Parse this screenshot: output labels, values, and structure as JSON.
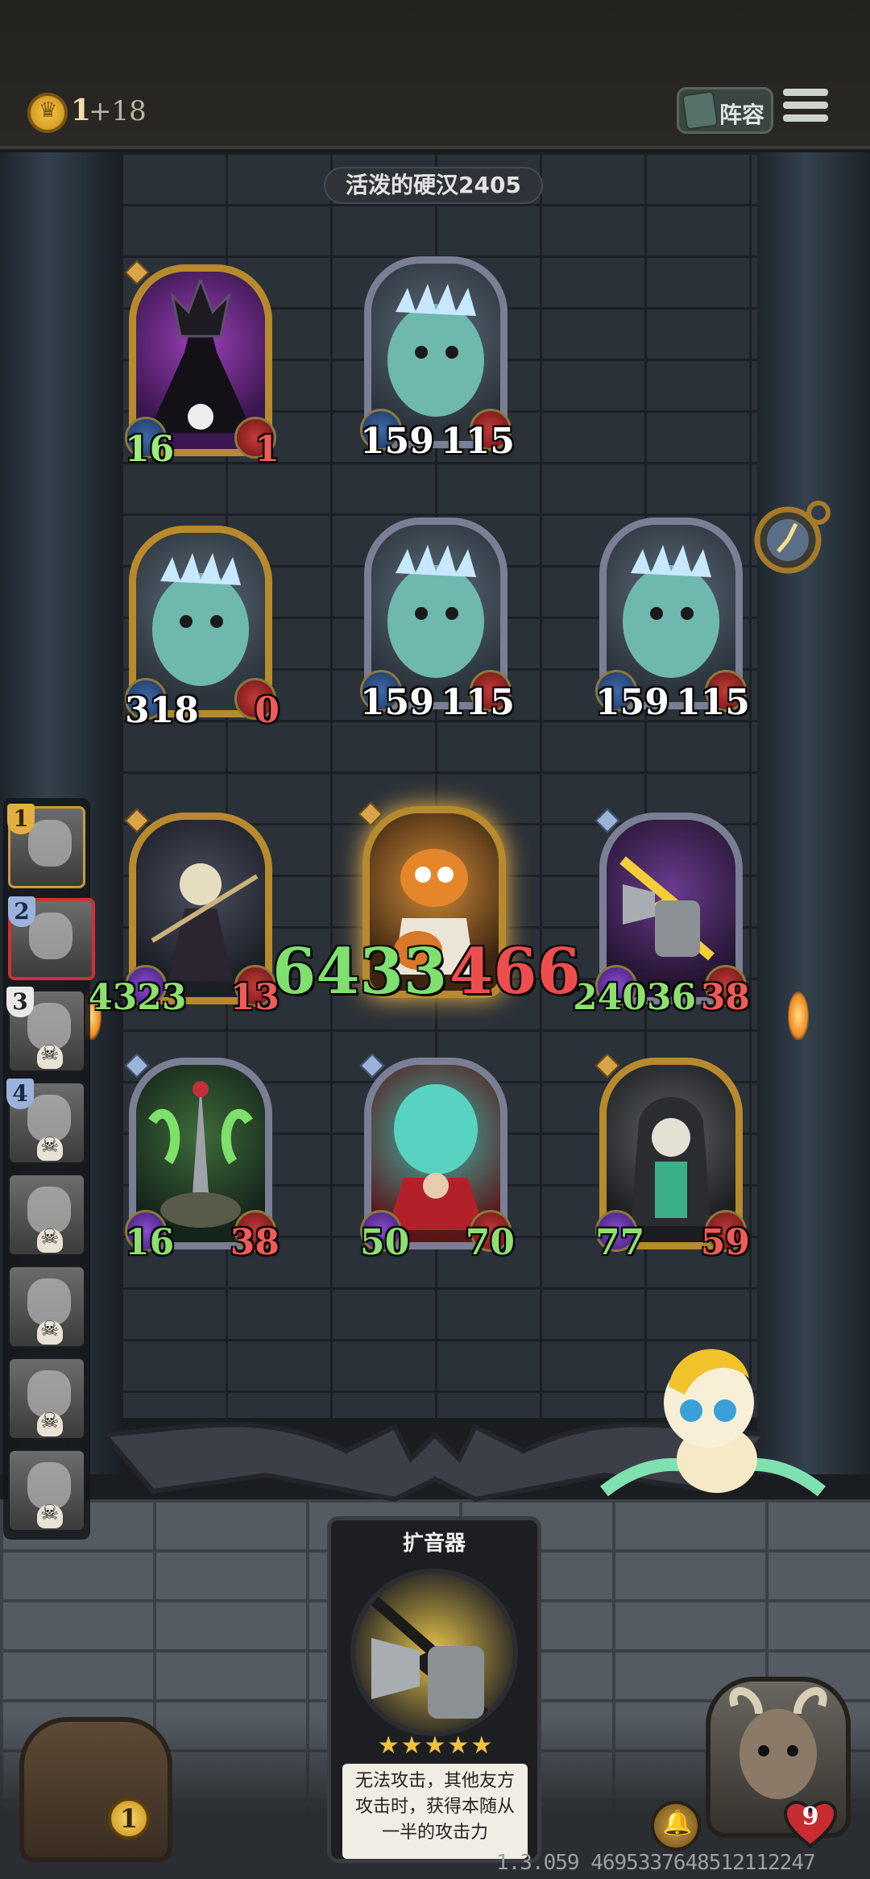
{
  "topbar": {
    "gold": "1",
    "gold_income": "+18",
    "lineup_label": "阵容"
  },
  "opponent": {
    "name": "活泼的硬汉2405"
  },
  "enemy_cards": [
    {
      "id": "king",
      "atk": "16",
      "hp": "1",
      "frame": "gold"
    },
    {
      "id": "ghoul1",
      "atk": "159",
      "hp": "115",
      "frame": "silver"
    },
    {
      "id": "ghoul2",
      "atk": "318",
      "hp": "0",
      "frame": "gold"
    },
    {
      "id": "ghoul3",
      "atk": "159",
      "hp": "115",
      "frame": "silver"
    },
    {
      "id": "ghoul4",
      "atk": "159",
      "hp": "115",
      "frame": "silver"
    }
  ],
  "player_cards": [
    {
      "id": "reaper",
      "atk": "4323",
      "hp": "13"
    },
    {
      "id": "pumpkin",
      "atk": "",
      "hp": ""
    },
    {
      "id": "megaphone",
      "atk": "24036",
      "hp": "38"
    },
    {
      "id": "sword",
      "atk": "16",
      "hp": "38"
    },
    {
      "id": "spirit",
      "atk": "50",
      "hp": "70"
    },
    {
      "id": "death",
      "atk": "77",
      "hp": "59"
    }
  ],
  "damage_popup": {
    "green": "6433",
    "red": "466"
  },
  "roster": {
    "slots": [
      "1",
      "2",
      "3",
      "4"
    ]
  },
  "info_card": {
    "title": "扩音器",
    "stars": "★★★★★",
    "description": "无法攻击，其他友方攻击时，获得本随从一半的攻击力"
  },
  "chest": {
    "count": "1"
  },
  "hero": {
    "hp": "9"
  },
  "version": "1.3.059 4695337648512112247"
}
